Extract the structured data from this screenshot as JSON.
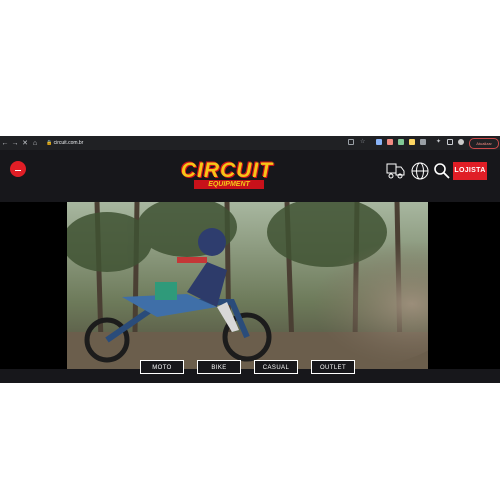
{
  "browser": {
    "back_icon": "back-arrow-icon",
    "forward_icon": "forward-arrow-icon",
    "stop_icon": "close-icon",
    "home_icon": "home-icon",
    "url": "circuit.com.br",
    "profile_label": "Atualizar"
  },
  "header": {
    "logo_main": "CIRCUIT",
    "logo_sub": "EQUIPMENT",
    "menu_icon": "menu-icon",
    "delivery_icon": "delivery-truck-icon",
    "globe_icon": "globe-icon",
    "search_icon": "search-icon",
    "store_button": "LOJISTA",
    "accent_color": "#e01e26",
    "logo_color": "#f5c518"
  },
  "categories": [
    {
      "label": "MOTO"
    },
    {
      "label": "BIKE"
    },
    {
      "label": "CASUAL"
    },
    {
      "label": "OUTLET"
    }
  ]
}
